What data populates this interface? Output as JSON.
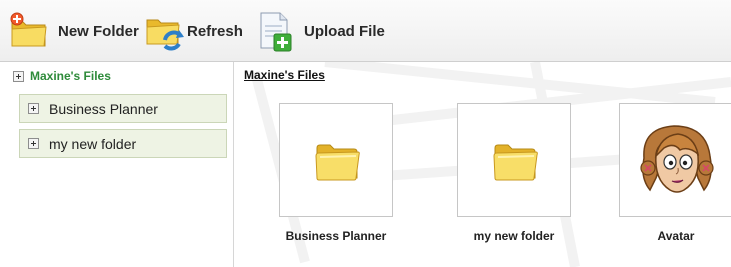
{
  "toolbar": {
    "new_folder": {
      "label": "New Folder",
      "icon": "new-folder-icon"
    },
    "refresh": {
      "label": "Refresh",
      "icon": "refresh-icon"
    },
    "upload": {
      "label": "Upload File",
      "icon": "upload-file-icon"
    }
  },
  "sidebar": {
    "root_label": "Maxine's Files",
    "items": [
      {
        "label": "Business Planner"
      },
      {
        "label": "my new folder"
      }
    ]
  },
  "main": {
    "breadcrumb": "Maxine's Files",
    "tiles": [
      {
        "label": "Business Planner",
        "icon": "folder-icon"
      },
      {
        "label": "my new folder",
        "icon": "folder-icon"
      },
      {
        "label": "Avatar",
        "icon": "avatar-image"
      }
    ]
  },
  "colors": {
    "root_label": "#2e8b3a",
    "tree_item_bg": "#eef3e4",
    "folder_yellow": "#f5d34a"
  }
}
